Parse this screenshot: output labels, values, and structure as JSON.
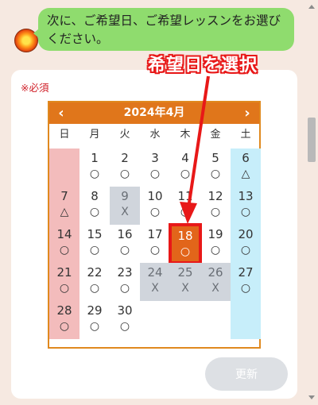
{
  "chat": {
    "message": "次に、ご希望日、ご希望レッスンをお選びください。"
  },
  "form": {
    "required_label": "※必須",
    "update_label": "更新"
  },
  "annotation": {
    "text": "希望日を選択",
    "color": "#e81818"
  },
  "calendar": {
    "title": "2024年4月",
    "prev_label": "‹",
    "next_label": "›",
    "weekdays": [
      "日",
      "月",
      "火",
      "水",
      "木",
      "金",
      "土"
    ],
    "selected_day": 18,
    "weeks": [
      [
        null,
        {
          "day": "1",
          "mark": "○"
        },
        {
          "day": "2",
          "mark": "○"
        },
        {
          "day": "3",
          "mark": "○"
        },
        {
          "day": "4",
          "mark": "○"
        },
        {
          "day": "5",
          "mark": "○"
        },
        {
          "day": "6",
          "mark": "△"
        }
      ],
      [
        {
          "day": "7",
          "mark": "△"
        },
        {
          "day": "8",
          "mark": "○"
        },
        {
          "day": "9",
          "mark": "X",
          "full": true
        },
        {
          "day": "10",
          "mark": "○"
        },
        {
          "day": "11",
          "mark": "○"
        },
        {
          "day": "12",
          "mark": "○"
        },
        {
          "day": "13",
          "mark": "○"
        }
      ],
      [
        {
          "day": "14",
          "mark": "○"
        },
        {
          "day": "15",
          "mark": "○"
        },
        {
          "day": "16",
          "mark": "○"
        },
        {
          "day": "17",
          "mark": "○"
        },
        {
          "day": "18",
          "mark": "○",
          "selected": true
        },
        {
          "day": "19",
          "mark": "○"
        },
        {
          "day": "20",
          "mark": "○"
        }
      ],
      [
        {
          "day": "21",
          "mark": "○"
        },
        {
          "day": "22",
          "mark": "○"
        },
        {
          "day": "23",
          "mark": "○"
        },
        {
          "day": "24",
          "mark": "X",
          "full": true
        },
        {
          "day": "25",
          "mark": "X",
          "full": true
        },
        {
          "day": "26",
          "mark": "X",
          "full": true
        },
        {
          "day": "27",
          "mark": "○"
        }
      ],
      [
        {
          "day": "28",
          "mark": "○"
        },
        {
          "day": "29",
          "mark": "○"
        },
        {
          "day": "30",
          "mark": "○"
        },
        null,
        null,
        null,
        null
      ]
    ]
  },
  "colors": {
    "header": "#e0761b",
    "bubble": "#8fdc6e",
    "sunday": "#f3bcbc",
    "saturday": "#c7eefa",
    "full": "#d0d5dc",
    "selected": "#e2651a"
  }
}
